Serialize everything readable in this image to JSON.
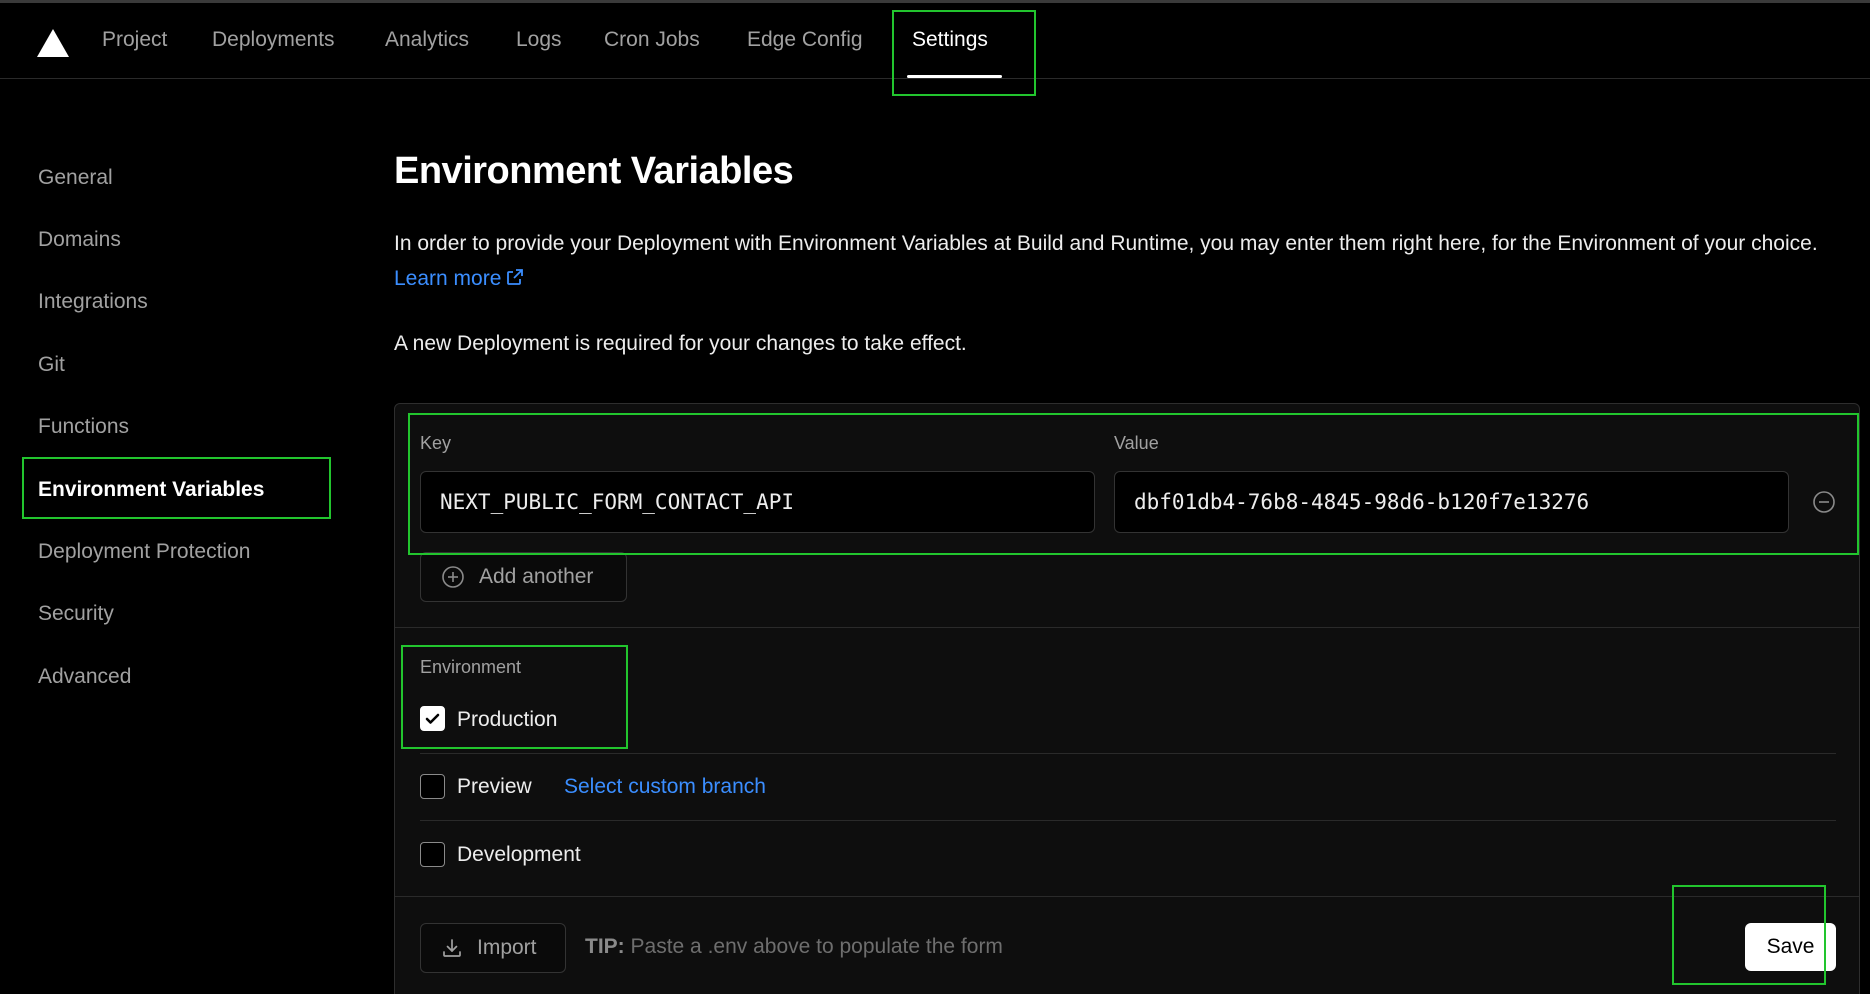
{
  "topnav": {
    "items": [
      "Project",
      "Deployments",
      "Analytics",
      "Logs",
      "Cron Jobs",
      "Edge Config",
      "Settings"
    ],
    "active": "Settings"
  },
  "sidebar": {
    "items": [
      "General",
      "Domains",
      "Integrations",
      "Git",
      "Functions",
      "Environment Variables",
      "Deployment Protection",
      "Security",
      "Advanced"
    ],
    "active": "Environment Variables"
  },
  "main": {
    "title": "Environment Variables",
    "description": "In order to provide your Deployment with Environment Variables at Build and Runtime, you may enter them right here, for the Environment of your choice.",
    "learn_more": "Learn more",
    "note": "A new Deployment is required for your changes to take effect."
  },
  "form": {
    "key_label": "Key",
    "value_label": "Value",
    "key_value": "NEXT_PUBLIC_FORM_CONTACT_API",
    "value_value": "dbf01db4-76b8-4845-98d6-b120f7e13276",
    "add_another": "Add another",
    "environment_label": "Environment",
    "environments": [
      {
        "label": "Production",
        "checked": true
      },
      {
        "label": "Preview",
        "checked": false
      },
      {
        "label": "Development",
        "checked": false
      }
    ],
    "select_branch": "Select custom branch",
    "import_label": "Import",
    "tip_label": "TIP:",
    "tip_text": "Paste a .env above to populate the form",
    "save_label": "Save"
  },
  "colors": {
    "background": "#000000",
    "link": "#3b8eff",
    "highlight": "#22c52e"
  }
}
